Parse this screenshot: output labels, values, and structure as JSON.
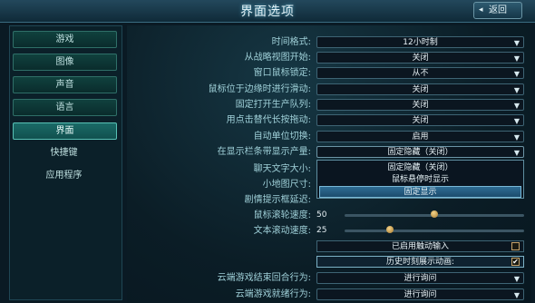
{
  "header": {
    "title": "界面选项",
    "back_label": "返回"
  },
  "sidebar": {
    "items": [
      {
        "label": "游戏"
      },
      {
        "label": "图像"
      },
      {
        "label": "声音"
      },
      {
        "label": "语言"
      },
      {
        "label": "界面"
      },
      {
        "label": "快捷键"
      },
      {
        "label": "应用程序"
      }
    ],
    "active": "界面"
  },
  "settings": {
    "time_format": {
      "label": "时间格式:",
      "value": "12小时制"
    },
    "battle_view": {
      "label": "从战略视图开始:",
      "value": "关闭"
    },
    "cursor_lock": {
      "label": "窗口鼠标锁定:",
      "value": "从不"
    },
    "edge_scroll": {
      "label": "鼠标位于边缘时进行滑动:",
      "value": "关闭"
    },
    "production_queue": {
      "label": "固定打开生产队列:",
      "value": "关闭"
    },
    "long_press": {
      "label": "用点击替代长按拖动:",
      "value": "关闭"
    },
    "auto_cycle": {
      "label": "自动单位切换:",
      "value": "启用"
    },
    "status_bar_show": {
      "label": "在显示栏条带显示产量:",
      "value": "固定隐藏（关闭）"
    },
    "chat_font": {
      "label": "聊天文字大小:"
    },
    "minimap": {
      "label": "小地图尺寸:"
    },
    "tooltip_delay": {
      "label": "剧情提示框延迟:"
    },
    "scroll_speed": {
      "label": "鼠标滚轮速度:",
      "value": "50",
      "fraction": 0.5
    },
    "text_speed": {
      "label": "文本滚动速度:",
      "value": "25",
      "fraction": 0.25
    },
    "touch_input": {
      "label": "已启用触动输入",
      "checked": false
    },
    "history_anim": {
      "label": "历史时刻展示动画:",
      "checked": true
    },
    "cloud_end": {
      "label": "云端游戏结束回合行为:",
      "value": "进行询问"
    },
    "cloud_ready": {
      "label": "云端游戏就绪行为:",
      "value": "进行询问"
    }
  },
  "dropdown_open": {
    "options": [
      "固定隐藏（关闭）",
      "鼠标悬停时显示",
      "固定显示"
    ],
    "highlighted": "固定显示"
  },
  "icons": {
    "chevron": "chevron-down-icon",
    "back": "back-arrow-icon",
    "check": "checkmark-icon"
  }
}
